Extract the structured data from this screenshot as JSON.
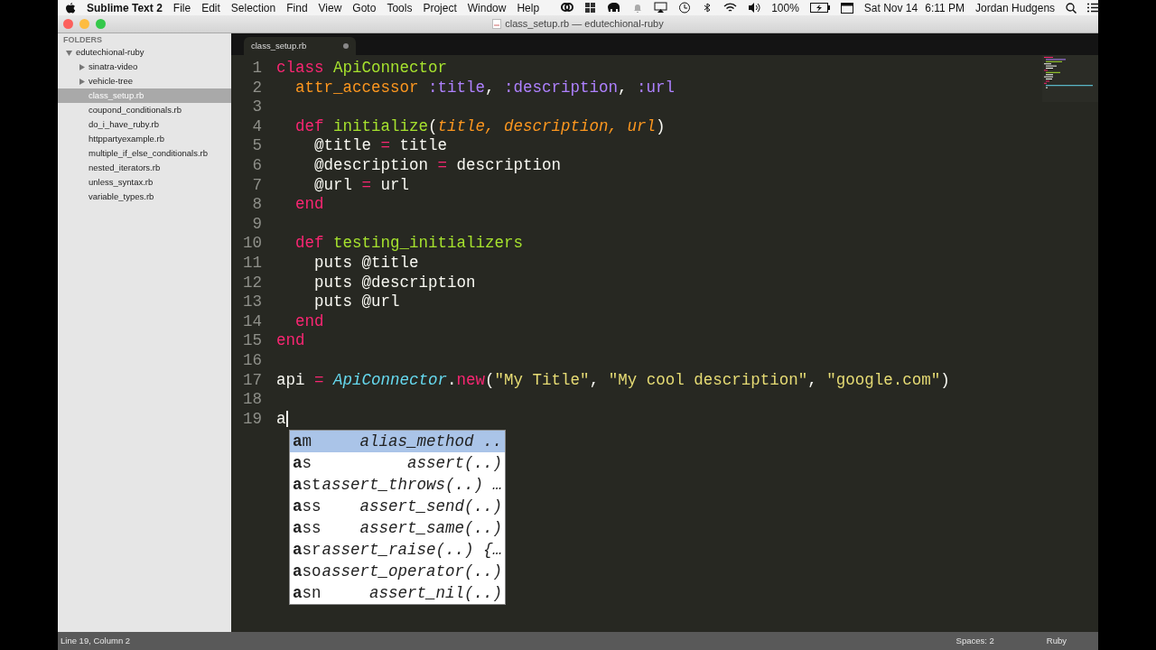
{
  "menu_bar": {
    "app_name": "Sublime Text 2",
    "menus": [
      "File",
      "Edit",
      "Selection",
      "Find",
      "View",
      "Goto",
      "Tools",
      "Project",
      "Window",
      "Help"
    ],
    "battery": "100%",
    "date": "Sat Nov 14",
    "time": "6:11 PM",
    "user": "Jordan Hudgens"
  },
  "window": {
    "title": "class_setup.rb — edutechional-ruby"
  },
  "sidebar": {
    "heading": "FOLDERS",
    "items": [
      {
        "label": "edutechional-ruby",
        "kind": "folder",
        "expanded": true,
        "selected": false,
        "children": [
          {
            "label": "sinatra-video",
            "kind": "folder",
            "expanded": false,
            "selected": false
          },
          {
            "label": "vehicle-tree",
            "kind": "folder",
            "expanded": false,
            "selected": false
          },
          {
            "label": "class_setup.rb",
            "kind": "file",
            "selected": true
          },
          {
            "label": "coupond_conditionals.rb",
            "kind": "file",
            "selected": false
          },
          {
            "label": "do_i_have_ruby.rb",
            "kind": "file",
            "selected": false
          },
          {
            "label": "httppartyexample.rb",
            "kind": "file",
            "selected": false
          },
          {
            "label": "multiple_if_else_conditionals.rb",
            "kind": "file",
            "selected": false
          },
          {
            "label": "nested_iterators.rb",
            "kind": "file",
            "selected": false
          },
          {
            "label": "unless_syntax.rb",
            "kind": "file",
            "selected": false
          },
          {
            "label": "variable_types.rb",
            "kind": "file",
            "selected": false
          }
        ]
      }
    ]
  },
  "tabs": [
    {
      "label": "class_setup.rb",
      "selected": true,
      "modified": true
    }
  ],
  "editor": {
    "lines": [
      {
        "number": "1",
        "tokens": [
          {
            "kind": "keyword",
            "text": "class"
          },
          {
            "kind": "entity",
            "text": " ApiConnector"
          }
        ]
      },
      {
        "number": "2",
        "tokens": [
          {
            "kind": "special",
            "text": "  attr_accessor"
          },
          {
            "kind": "symbol",
            "text": " :title"
          },
          {
            "kind": "plain",
            "text": ", "
          },
          {
            "kind": "symbol",
            "text": ":description"
          },
          {
            "kind": "plain",
            "text": ", "
          },
          {
            "kind": "symbol",
            "text": ":url"
          }
        ]
      },
      {
        "number": "3"
      },
      {
        "number": "4",
        "tokens": [
          {
            "kind": "keyword",
            "text": "  def"
          },
          {
            "kind": "entity",
            "text": " initialize"
          },
          {
            "kind": "plain",
            "text": "("
          },
          {
            "kind": "param",
            "text": "title, description, url"
          },
          {
            "kind": "plain",
            "text": ")"
          }
        ]
      },
      {
        "number": "5",
        "tokens": [
          {
            "kind": "plain",
            "text": "    @title "
          },
          {
            "kind": "keyword",
            "text": "="
          },
          {
            "kind": "plain",
            "text": " title"
          }
        ]
      },
      {
        "number": "6",
        "tokens": [
          {
            "kind": "plain",
            "text": "    @description "
          },
          {
            "kind": "keyword",
            "text": "="
          },
          {
            "kind": "plain",
            "text": " description"
          }
        ]
      },
      {
        "number": "7",
        "tokens": [
          {
            "kind": "plain",
            "text": "    @url "
          },
          {
            "kind": "keyword",
            "text": "="
          },
          {
            "kind": "plain",
            "text": " url"
          }
        ]
      },
      {
        "number": "8",
        "tokens": [
          {
            "kind": "keyword",
            "text": "  end"
          }
        ]
      },
      {
        "number": "9"
      },
      {
        "number": "10",
        "tokens": [
          {
            "kind": "keyword",
            "text": "  def"
          },
          {
            "kind": "entity",
            "text": " testing_initializers"
          }
        ]
      },
      {
        "number": "11",
        "tokens": [
          {
            "kind": "plain",
            "text": "    puts @title"
          }
        ]
      },
      {
        "number": "12",
        "tokens": [
          {
            "kind": "plain",
            "text": "    puts @description"
          }
        ]
      },
      {
        "number": "13",
        "tokens": [
          {
            "kind": "plain",
            "text": "    puts @url"
          }
        ]
      },
      {
        "number": "14",
        "tokens": [
          {
            "kind": "keyword",
            "text": "  end"
          }
        ]
      },
      {
        "number": "15",
        "tokens": [
          {
            "kind": "keyword",
            "text": "end"
          }
        ]
      },
      {
        "number": "16"
      },
      {
        "number": "17",
        "tokens": [
          {
            "kind": "plain",
            "text": "api "
          },
          {
            "kind": "keyword",
            "text": "="
          },
          {
            "kind": "support",
            "text": " ApiConnector"
          },
          {
            "kind": "plain",
            "text": "."
          },
          {
            "kind": "keyword",
            "text": "new"
          },
          {
            "kind": "plain",
            "text": "("
          },
          {
            "kind": "string",
            "text": "\"My Title\""
          },
          {
            "kind": "plain",
            "text": ", "
          },
          {
            "kind": "string",
            "text": "\"My cool description\""
          },
          {
            "kind": "plain",
            "text": ", "
          },
          {
            "kind": "string",
            "text": "\"google.com\""
          },
          {
            "kind": "plain",
            "text": ")"
          }
        ]
      },
      {
        "number": "18"
      },
      {
        "number": "19",
        "tokens": [
          {
            "kind": "plain",
            "text": "a"
          }
        ],
        "caret": true
      }
    ],
    "autocomplete": [
      {
        "trigger": "**a**m",
        "completion": "alias_method ..",
        "selected": true
      },
      {
        "trigger": "**a**s",
        "completion": "assert(..)",
        "selected": false
      },
      {
        "trigger": "**a**st",
        "completion": "assert_throws(..) …",
        "selected": false
      },
      {
        "trigger": "**a**ss",
        "completion": "assert_send(..)",
        "selected": false
      },
      {
        "trigger": "**a**ss",
        "completion": "assert_same(..)",
        "selected": false
      },
      {
        "trigger": "**a**sr",
        "completion": "assert_raise(..) {…",
        "selected": false
      },
      {
        "trigger": "**a**so",
        "completion": "assert_operator(..)",
        "selected": false
      },
      {
        "trigger": "**a**sn",
        "completion": "assert_nil(..)",
        "selected": false
      }
    ]
  },
  "status_bar": {
    "position": "Line 19, Column 2",
    "indentation": "Spaces: 2",
    "syntax": "Ruby"
  }
}
